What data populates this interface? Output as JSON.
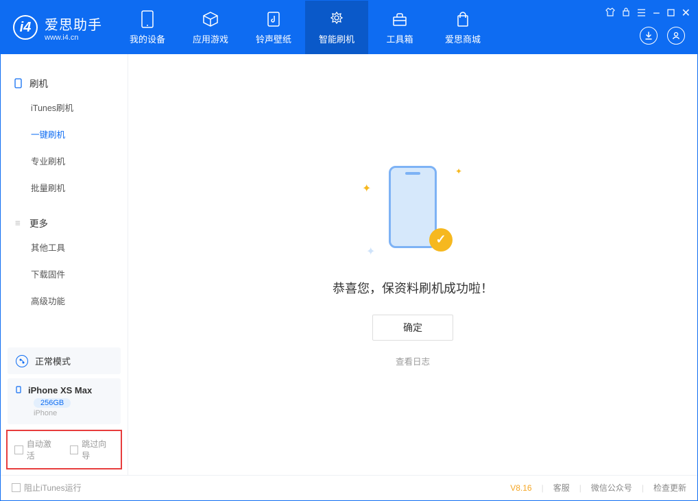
{
  "app": {
    "title": "爱思助手",
    "subtitle": "www.i4.cn"
  },
  "nav": {
    "device": "我的设备",
    "apps": "应用游戏",
    "ringtones": "铃声壁纸",
    "flash": "智能刷机",
    "toolbox": "工具箱",
    "store": "爱思商城"
  },
  "sidebar": {
    "flash_header": "刷机",
    "items": {
      "itunes": "iTunes刷机",
      "oneclick": "一键刷机",
      "pro": "专业刷机",
      "batch": "批量刷机"
    },
    "more_header": "更多",
    "more": {
      "other": "其他工具",
      "firmware": "下载固件",
      "advanced": "高级功能"
    },
    "mode": "正常模式",
    "device_name": "iPhone XS Max",
    "storage": "256GB",
    "device_type": "iPhone",
    "auto_activate": "自动激活",
    "skip_wizard": "跳过向导"
  },
  "main": {
    "success_msg": "恭喜您，保资料刷机成功啦！",
    "ok": "确定",
    "view_log": "查看日志"
  },
  "footer": {
    "block_itunes": "阻止iTunes运行",
    "version": "V8.16",
    "support": "客服",
    "wechat": "微信公众号",
    "update": "检查更新"
  }
}
